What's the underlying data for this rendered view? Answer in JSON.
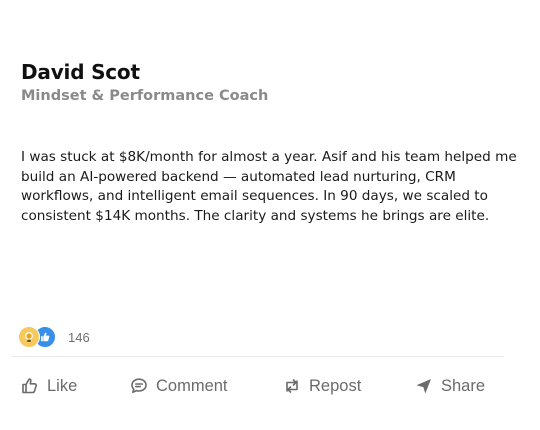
{
  "author": {
    "name": "David Scot",
    "headline": "Mindset & Performance Coach"
  },
  "post": {
    "body": "I was stuck at $8K/month for almost a year. Asif and his team helped me build an AI-powered backend — automated lead nurturing, CRM workflows, and intelligent email sequences. In 90 days, we scaled to consistent $14K months. The clarity and systems he brings are elite."
  },
  "reactions": {
    "icons": [
      "insightful-icon",
      "like-icon"
    ],
    "count": "146"
  },
  "actions": {
    "like": "Like",
    "comment": "Comment",
    "repost": "Repost",
    "share": "Share"
  },
  "colors": {
    "reaction_like": "#378fe9",
    "reaction_insightful": "#f5c95b",
    "action_text": "#6b6b6b",
    "name_text": "#111111",
    "headline_text": "#8a8a8a"
  }
}
